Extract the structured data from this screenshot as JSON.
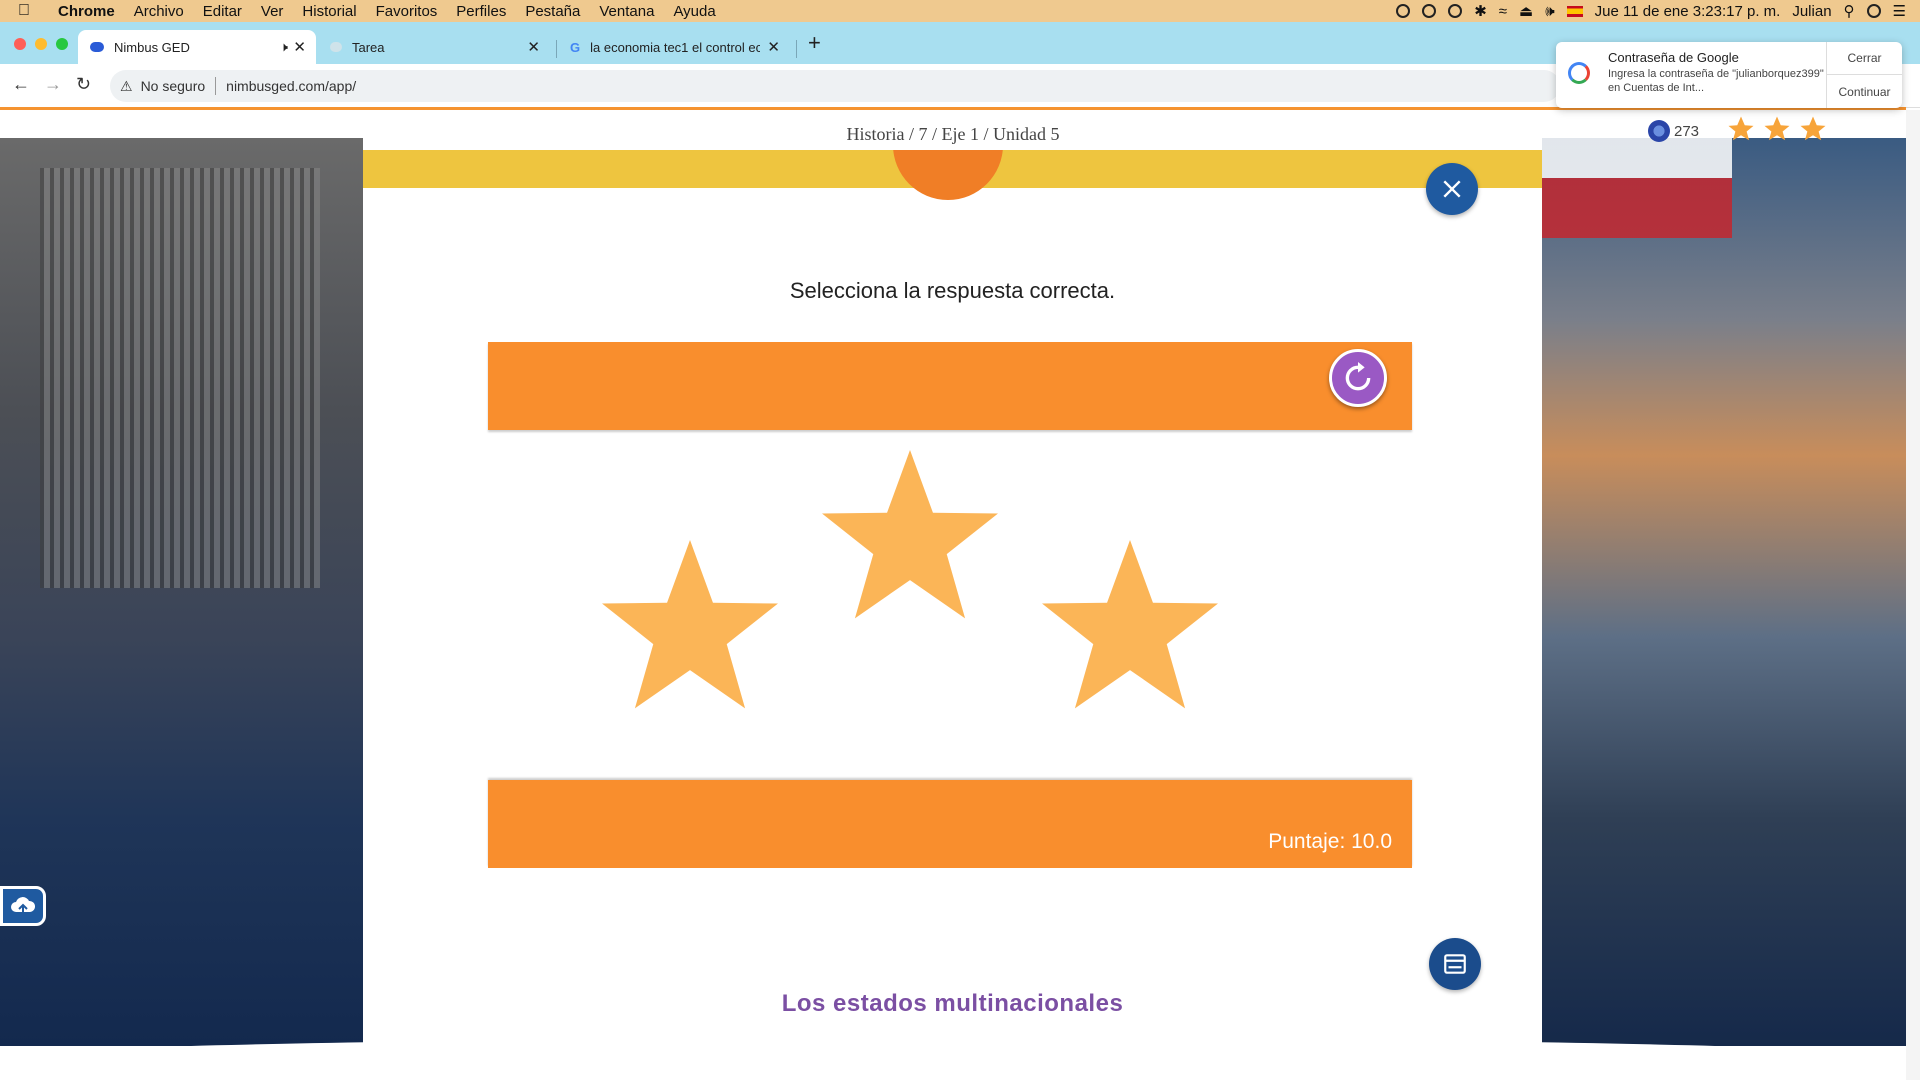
{
  "menubar": {
    "app": "Chrome",
    "items": [
      "Archivo",
      "Editar",
      "Ver",
      "Historial",
      "Favoritos",
      "Perfiles",
      "Pestaña",
      "Ventana",
      "Ayuda"
    ],
    "datetime": "Jue 11 de ene  3:23:17 p. m.",
    "user": "Julian"
  },
  "tabs": [
    {
      "title": "Nimbus GED",
      "active": true
    },
    {
      "title": "Tarea",
      "active": false
    },
    {
      "title": "la economia tec1 el control eco",
      "active": false
    }
  ],
  "addressbar": {
    "security": "No seguro",
    "url": "nimbusged.com/app/"
  },
  "password_popup": {
    "title": "Contraseña de Google",
    "text": "Ingresa la contraseña de \"julianborquez399\" en Cuentas de Int...",
    "close_label": "Cerrar",
    "continue_label": "Continuar"
  },
  "breadcrumb": "Historia  /  7  /  Eje 1  /  Unidad 5",
  "coins": "273",
  "header_stars": 3,
  "activity": {
    "instruction": "Selecciona la respuesta correcta.",
    "score": "Puntaje: 10.0",
    "stars_earned": 3,
    "lesson_title": "Los estados multinacionales"
  },
  "colors": {
    "orange_band": "#f98e2d",
    "star": "#fbb557",
    "yellow_bar": "#eec53f",
    "replay": "#9a59c4",
    "blue_button": "#1f5aa0",
    "lesson_title": "#7b4fa3"
  }
}
